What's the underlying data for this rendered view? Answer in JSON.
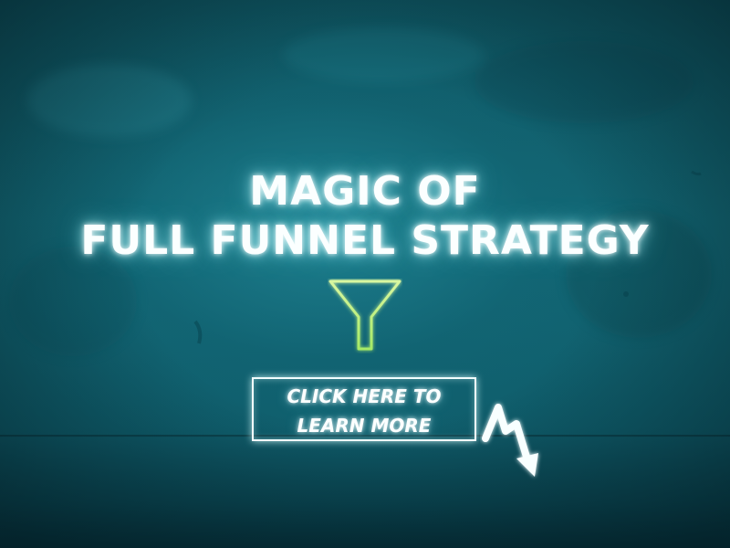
{
  "headline": {
    "line1": "MAGIC OF",
    "line2": "FULL FUNNEL STRATEGY"
  },
  "cta": {
    "line1": "CLICK HERE TO",
    "line2": "LEARN MORE"
  },
  "icons": {
    "funnel": "funnel-icon",
    "arrow": "curved-arrow-icon"
  },
  "colors": {
    "background": "#126572",
    "text": "#fbffff",
    "funnel_outline": "#b9f07a"
  }
}
